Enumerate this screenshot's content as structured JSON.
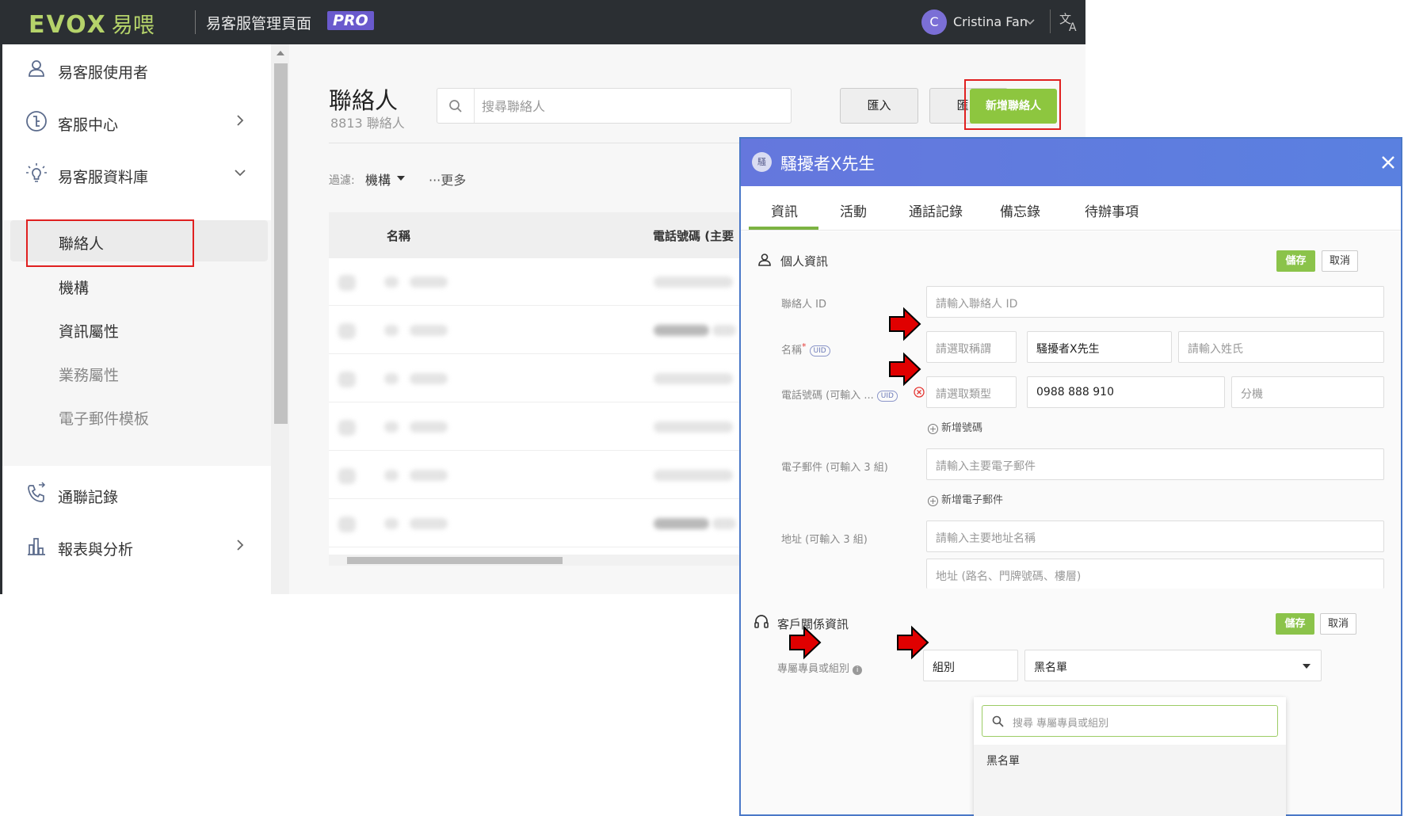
{
  "header": {
    "logo_text": "EVOX",
    "logo_cn": "易喂",
    "app_title": "易客服管理頁面",
    "pro_badge": "PRO",
    "avatar_letter": "C",
    "user_name": "Cristina Fan",
    "background": "#2b2f33",
    "logo_color": "#b5d36a"
  },
  "sidebar": {
    "items": [
      {
        "label": "易客服使用者",
        "icon": "user-icon"
      },
      {
        "label": "客服中心",
        "icon": "service-center-icon"
      },
      {
        "label": "易客服資料庫",
        "icon": "lightbulb-icon"
      },
      {
        "label": "通聯記錄",
        "icon": "phone-log-icon"
      },
      {
        "label": "報表與分析",
        "icon": "bar-chart-icon"
      }
    ],
    "sub_items": [
      {
        "label": "聯絡人",
        "state": "active"
      },
      {
        "label": "機構",
        "state": "normal"
      },
      {
        "label": "資訊屬性",
        "state": "normal"
      },
      {
        "label": "業務屬性",
        "state": "disabled"
      },
      {
        "label": "電子郵件模板",
        "state": "disabled"
      }
    ]
  },
  "main": {
    "title": "聯絡人",
    "count": "8813 聯絡人",
    "search_placeholder": "搜尋聯絡人",
    "import_label": "匯入",
    "export_label": "匯出",
    "add_label": "新增聯絡人",
    "filter_label": "過濾:",
    "filter_value": "機構",
    "filter_more": "更多",
    "table": {
      "columns": [
        "名稱",
        "電話號碼 (主要"
      ]
    }
  },
  "panel": {
    "avatar_text": "騷",
    "title": "騷擾者X先生",
    "tabs": [
      "資訊",
      "活動",
      "通話記錄",
      "備忘錄",
      "待辦事項"
    ],
    "active_tab": "資訊",
    "personal": {
      "title": "個人資訊",
      "save": "儲存",
      "cancel": "取消",
      "contact_id_label": "聯絡人 ID",
      "contact_id_placeholder": "請輸入聯絡人 ID",
      "name_label": "名稱",
      "name_required": "*",
      "uid_tag": "UID",
      "salutation_placeholder": "請選取稱謂",
      "given_name_value": "騷擾者X先生",
      "surname_placeholder": "請輸入姓氏",
      "phone_label": "電話號碼 (可輸入 ...",
      "phone_type_placeholder": "請選取類型",
      "phone_value": "0988 888 910",
      "ext_placeholder": "分機",
      "add_phone": "新增號碼",
      "email_label": "電子郵件 (可輸入 3 組)",
      "email_placeholder": "請輸入主要電子郵件",
      "add_email": "新增電子郵件",
      "address_label": "地址 (可輸入 3 組)",
      "address_name_placeholder": "請輸入主要地址名稱",
      "address_detail_placeholder": "地址 (路名、門牌號碼、樓層)"
    },
    "crm": {
      "title": "客戶關係資訊",
      "save": "儲存",
      "cancel": "取消",
      "owner_label": "專屬專員或組別",
      "owner_type": "組別",
      "owner_value": "黑名單",
      "dropdown_search_placeholder": "搜尋 專屬專員或組別",
      "dropdown_option": "黑名單"
    }
  },
  "colors": {
    "accent_green": "#8dc63f",
    "highlight_red": "#e02020",
    "panel_header": "#5a80e0"
  }
}
